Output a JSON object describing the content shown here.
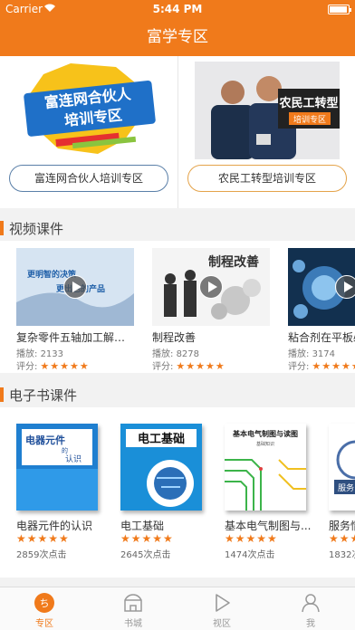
{
  "status": {
    "carrier": "Carrier",
    "time": "5:44 PM"
  },
  "header": {
    "title": "富学专区"
  },
  "zones": [
    {
      "label": "富连网合伙人培训专区",
      "banner_text": [
        "富连网合伙人",
        "培训专区"
      ]
    },
    {
      "label": "农民工转型培训专区",
      "banner_text": [
        "农民工转型",
        "培训专区"
      ]
    }
  ],
  "video_section": {
    "title": "视频课件",
    "items": [
      {
        "title": "复杂零件五轴加工解决...",
        "plays_label": "播放:",
        "plays": "2133",
        "rating_label": "评分:",
        "rating": 5,
        "thumb_text": [
          "更明智的决策",
          "更出色的产品"
        ]
      },
      {
        "title": "制程改善",
        "plays_label": "播放:",
        "plays": "8278",
        "rating_label": "评分:",
        "rating": 4.5,
        "thumb_text": [
          "制程改善"
        ]
      },
      {
        "title": "粘合剂在平板必",
        "plays_label": "播放:",
        "plays": "3174",
        "rating_label": "评分:",
        "rating": 4.5
      }
    ]
  },
  "ebook_section": {
    "title": "电子书课件",
    "items": [
      {
        "title": "电器元件的认识",
        "rating": 4.5,
        "clicks": "2859次点击",
        "cover_text": [
          "电器元件",
          "的",
          "认识"
        ]
      },
      {
        "title": "电工基础",
        "rating": 4.5,
        "clicks": "2645次点击",
        "cover_text": [
          "电工基础"
        ]
      },
      {
        "title": "基本电气制图与...",
        "rating": 5,
        "clicks": "1474次点击",
        "cover_text": [
          "基本电气制图与读图",
          "基础知识"
        ]
      },
      {
        "title": "服务情",
        "rating": 4,
        "clicks": "1832次",
        "cover_text": [
          "服务"
        ]
      }
    ]
  },
  "tabs": [
    {
      "label": "专区",
      "icon": "zone-icon",
      "active": true
    },
    {
      "label": "书城",
      "icon": "bookstore-icon",
      "active": false
    },
    {
      "label": "视区",
      "icon": "video-icon",
      "active": false
    },
    {
      "label": "我",
      "icon": "profile-icon",
      "active": false
    }
  ],
  "colors": {
    "accent": "#f07a1b",
    "star": "#f07a1b"
  }
}
